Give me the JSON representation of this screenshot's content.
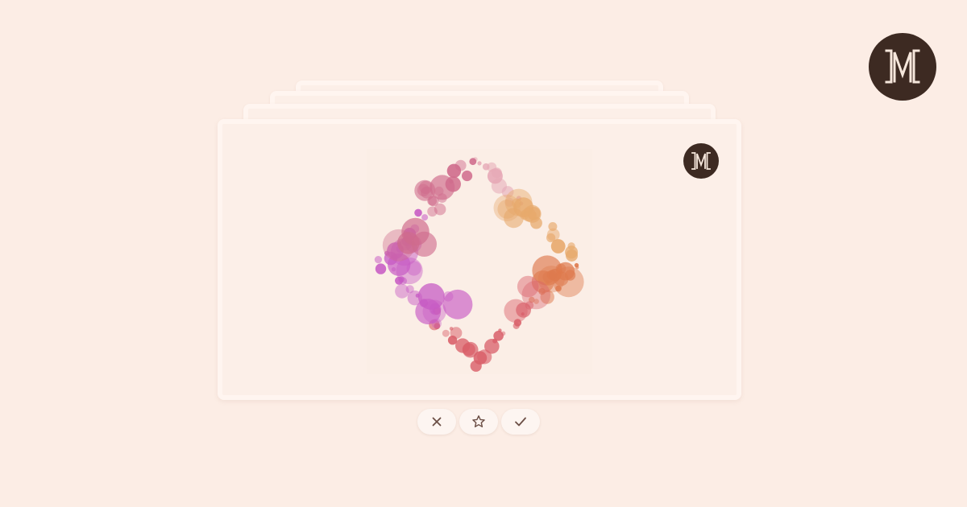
{
  "brand": {
    "logo_icon": "monogram-m-icon",
    "logo_bg": "#3d2a22",
    "logo_fg": "#f6e7dc"
  },
  "colors": {
    "background": "#fcede5",
    "card": "#fcefe8",
    "card_border": "#fff5f0",
    "button_bg": "#fdf5f1",
    "button_icon": "#6b4e45"
  },
  "card_stack": {
    "behind_cards": 3
  },
  "artwork": {
    "palette": [
      "#cf6b8c",
      "#c75bc4",
      "#e7a96b",
      "#de7a4e",
      "#d9606a",
      "#e6a9b6"
    ]
  },
  "actions": [
    {
      "name": "dismiss-button",
      "icon": "close-icon"
    },
    {
      "name": "favorite-button",
      "icon": "star-icon"
    },
    {
      "name": "accept-button",
      "icon": "check-icon"
    }
  ]
}
